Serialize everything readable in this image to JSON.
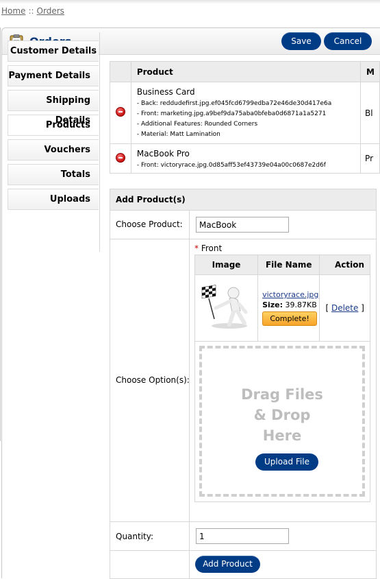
{
  "breadcrumb": {
    "home": "Home",
    "separator": "::",
    "current": "Orders"
  },
  "heading": {
    "title": "Orders",
    "save_label": "Save",
    "cancel_label": "Cancel",
    "icon": "clipboard-icon"
  },
  "tabs": [
    {
      "label": "Customer Details"
    },
    {
      "label": "Payment Details"
    },
    {
      "label": "Shipping Details"
    },
    {
      "label": "Products"
    },
    {
      "label": "Vouchers"
    },
    {
      "label": "Totals"
    },
    {
      "label": "Uploads"
    }
  ],
  "products_table": {
    "headers": {
      "product": "Product",
      "model": "M"
    },
    "rows": [
      {
        "name": "Business Card",
        "attrs": [
          "- Back: reddudefirst.jpg.ef045fcd6799edba72e46de30d417e6a",
          "- Front: marketing.jpg.a9bef9da75aba0bfeba0d6871a1a5271",
          "- Additional Features: Rounded Corners",
          "- Material: Matt Lamination"
        ],
        "model": "Bl"
      },
      {
        "name": "MacBook Pro",
        "attrs": [
          "- Front: victoryrace.jpg.0d85aff53ef43739e04a00c0687e2d6f"
        ],
        "model": "Pr"
      }
    ]
  },
  "add_product": {
    "heading": "Add Product(s)",
    "choose_product_label": "Choose Product:",
    "choose_product_value": "MacBook",
    "choose_options_label": "Choose Option(s):",
    "option_required_mark": "*",
    "option_name": "Front",
    "options_headers": {
      "image": "Image",
      "file_name": "File Name",
      "action": "Action"
    },
    "file": {
      "name": "victoryrace.jpg",
      "size_label": "Size:",
      "size_value": "39.87KB",
      "status": "Complete!",
      "delete_open": "[",
      "delete_label": "Delete",
      "delete_close": "]"
    },
    "dropzone_lines": [
      "Drag Files",
      "& Drop",
      "Here"
    ],
    "upload_label": "Upload File",
    "quantity_label": "Quantity:",
    "quantity_value": "1",
    "add_button_label": "Add Product"
  },
  "colors": {
    "brand_blue": "#003b86",
    "heading_text": "#0b3c7a",
    "complete_orange": "#f7a428",
    "required_red": "#cc0000"
  }
}
